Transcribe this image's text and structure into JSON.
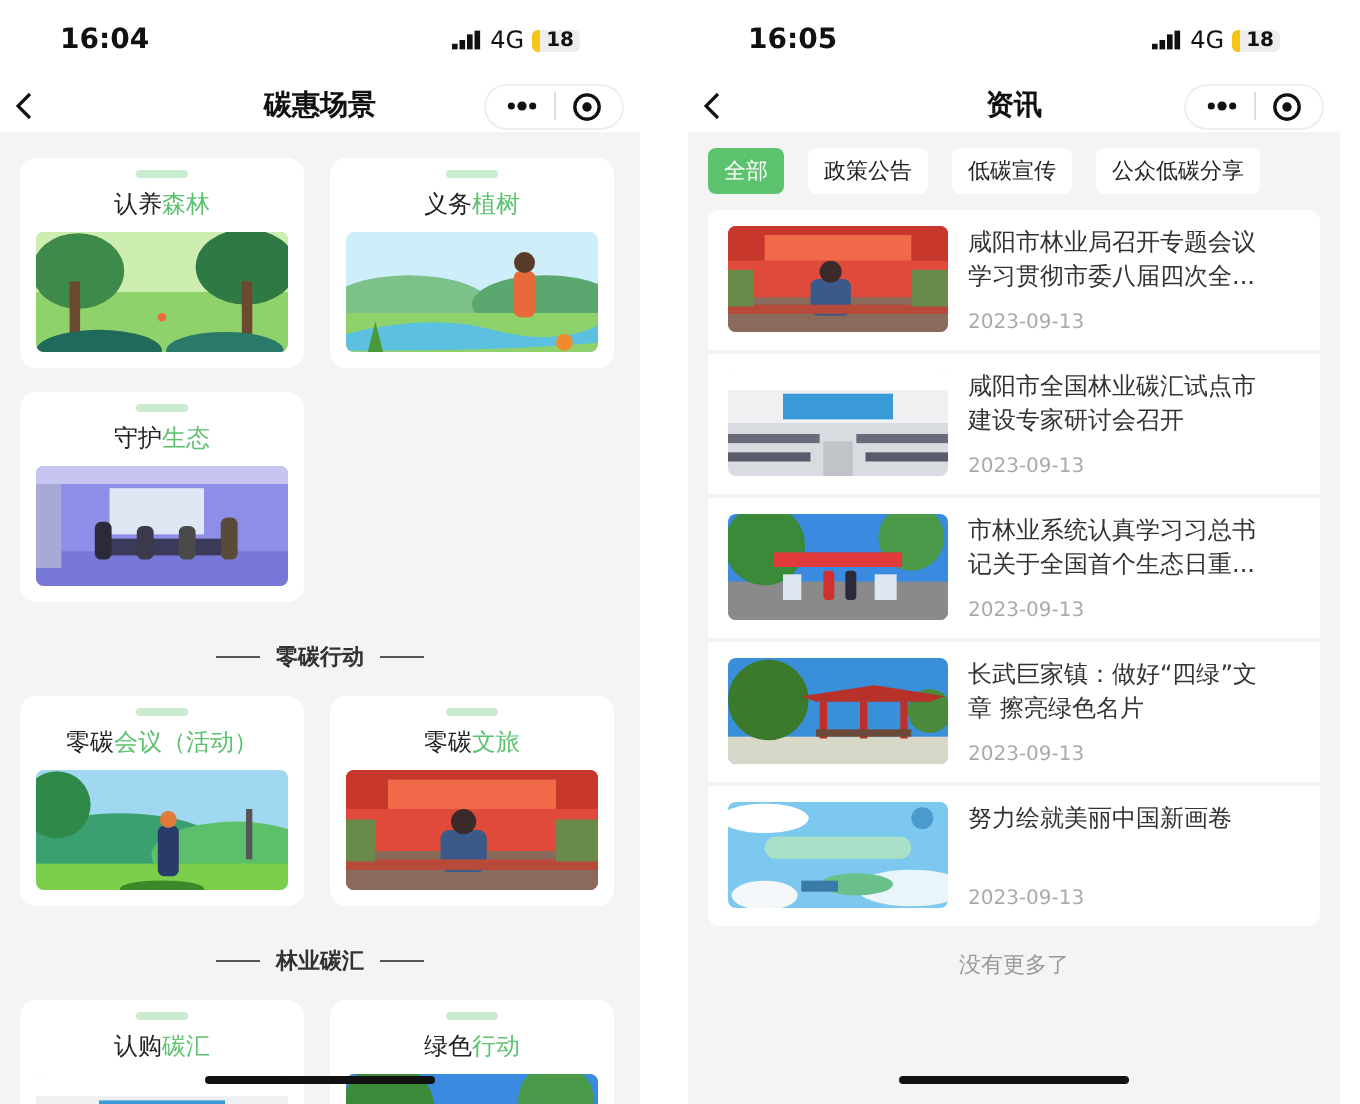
{
  "left_screen": {
    "status_bar": {
      "time": "16:04",
      "network": "4G",
      "battery": "18"
    },
    "nav": {
      "title": "碳惠场景"
    },
    "sections": [
      {
        "cards": [
          {
            "label": "认养",
            "accent": "森林"
          },
          {
            "label": "义务",
            "accent": "植树"
          },
          {
            "label": "守护",
            "accent": "生态"
          }
        ]
      },
      {
        "heading": "零碳行动",
        "cards": [
          {
            "label": "零碳",
            "accent": "会议（活动）"
          },
          {
            "label": "零碳",
            "accent": "文旅"
          }
        ]
      },
      {
        "heading": "林业碳汇",
        "cards": [
          {
            "label": "认购",
            "accent": "碳汇"
          },
          {
            "label": "绿色",
            "accent": "行动"
          }
        ]
      }
    ]
  },
  "right_screen": {
    "status_bar": {
      "time": "16:05",
      "network": "4G",
      "battery": "18"
    },
    "nav": {
      "title": "资讯"
    },
    "tabs": [
      {
        "label": "全部",
        "selected": true
      },
      {
        "label": "政策公告",
        "selected": false
      },
      {
        "label": "低碳宣传",
        "selected": false
      },
      {
        "label": "公众低碳分享",
        "selected": false
      }
    ],
    "news": [
      {
        "title": "咸阳市林业局召开专题会议学习贯彻市委八届四次全...",
        "date": "2023-09-13"
      },
      {
        "title": "咸阳市全国林业碳汇试点市建设专家研讨会召开",
        "date": "2023-09-13"
      },
      {
        "title": "市林业系统认真学习习总书记关于全国首个生态日重...",
        "date": "2023-09-13"
      },
      {
        "title": "长武巨家镇：做好“四绿”文章 擦亮绿色名片",
        "date": "2023-09-13"
      },
      {
        "title": "努力绘就美丽中国新画卷",
        "date": "2023-09-13"
      }
    ],
    "footer": "没有更多了"
  }
}
